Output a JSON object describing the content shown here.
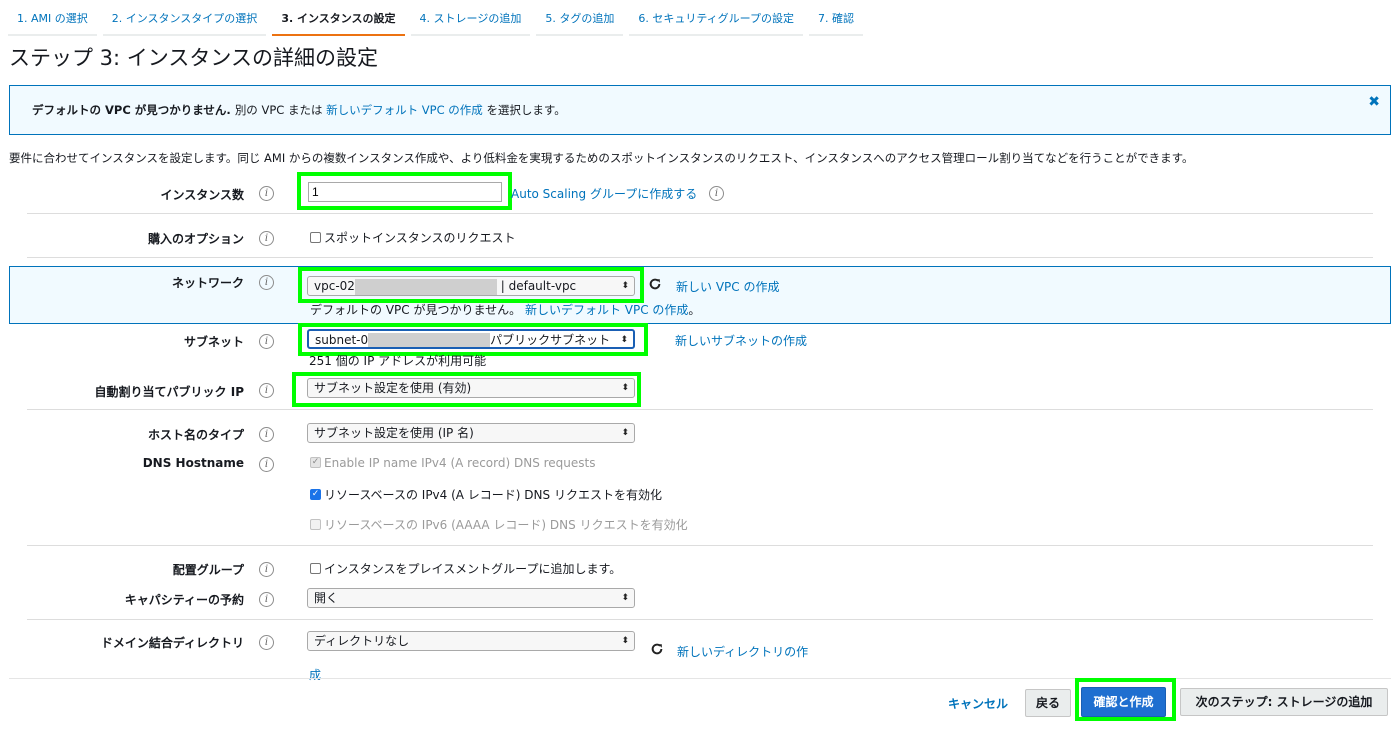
{
  "steps": [
    {
      "label": "1. AMI の選択"
    },
    {
      "label": "2. インスタンスタイプの選択"
    },
    {
      "label": "3. インスタンスの設定"
    },
    {
      "label": "4. ストレージの追加"
    },
    {
      "label": "5. タグの追加"
    },
    {
      "label": "6. セキュリティグループの設定"
    },
    {
      "label": "7. 確認"
    }
  ],
  "page_title": "ステップ 3: インスタンスの詳細の設定",
  "banner": {
    "bold": "デフォルトの VPC が見つかりません.",
    "text1": "別の VPC または",
    "link": "新しいデフォルト VPC の作成",
    "text2": "を選択します。",
    "close": "✖"
  },
  "description": "要件に合わせてインスタンスを設定します。同じ AMI からの複数インスタンス作成や、より低料金を実現するためのスポットインスタンスのリクエスト、インスタンスへのアクセス管理ロール割り当てなどを行うことができます。",
  "info_glyph": "i",
  "instance_count": {
    "label": "インスタンス数",
    "value": "1",
    "link": "Auto Scaling グループに作成する"
  },
  "purchase": {
    "label": "購入のオプション",
    "checkbox_label": "スポットインスタンスのリクエスト"
  },
  "network": {
    "label": "ネットワーク",
    "value_prefix": "vpc-02",
    "value_suffix": "| default-vpc",
    "link": "新しい VPC の作成",
    "warning": "デフォルトの VPC が見つかりません。",
    "warning_link": "新しいデフォルト VPC の作成",
    "warning_end": "。"
  },
  "subnet": {
    "label": "サブネット",
    "value_prefix": "subnet-0",
    "value_suffix": "パブリックサブネット",
    "link": "新しいサブネットの作成",
    "available": "251 個の IP アドレスが利用可能"
  },
  "public_ip": {
    "label": "自動割り当てパブリック IP",
    "value": "サブネット設定を使用 (有効)"
  },
  "hostname_type": {
    "label": "ホスト名のタイプ",
    "value": "サブネット設定を使用 (IP 名)"
  },
  "dns_hostname": {
    "label": "DNS Hostname",
    "option1": "Enable IP name IPv4 (A record) DNS requests",
    "option2": "リソースベースの IPv4 (A レコード) DNS リクエストを有効化",
    "option3": "リソースベースの IPv6 (AAAA レコード) DNS リクエストを有効化"
  },
  "placement": {
    "label": "配置グループ",
    "checkbox_label": "インスタンスをプレイスメントグループに追加します。"
  },
  "capacity": {
    "label": "キャパシティーの予約",
    "value": "開く"
  },
  "domain": {
    "label": "ドメイン結合ディレクトリ",
    "value": "ディレクトリなし",
    "link_line1": "新しいディレクトリの作",
    "link_line2": "成"
  },
  "select_arrow": "⬍",
  "check_mark": "✓",
  "buttons": {
    "cancel": "キャンセル",
    "back": "戻る",
    "review": "確認と作成",
    "next": "次のステップ: ストレージの追加"
  },
  "colors": {
    "link": "#0073bb",
    "highlight": "#00ff00",
    "primary": "#1f6fd0",
    "active_tab": "#ec7211"
  }
}
